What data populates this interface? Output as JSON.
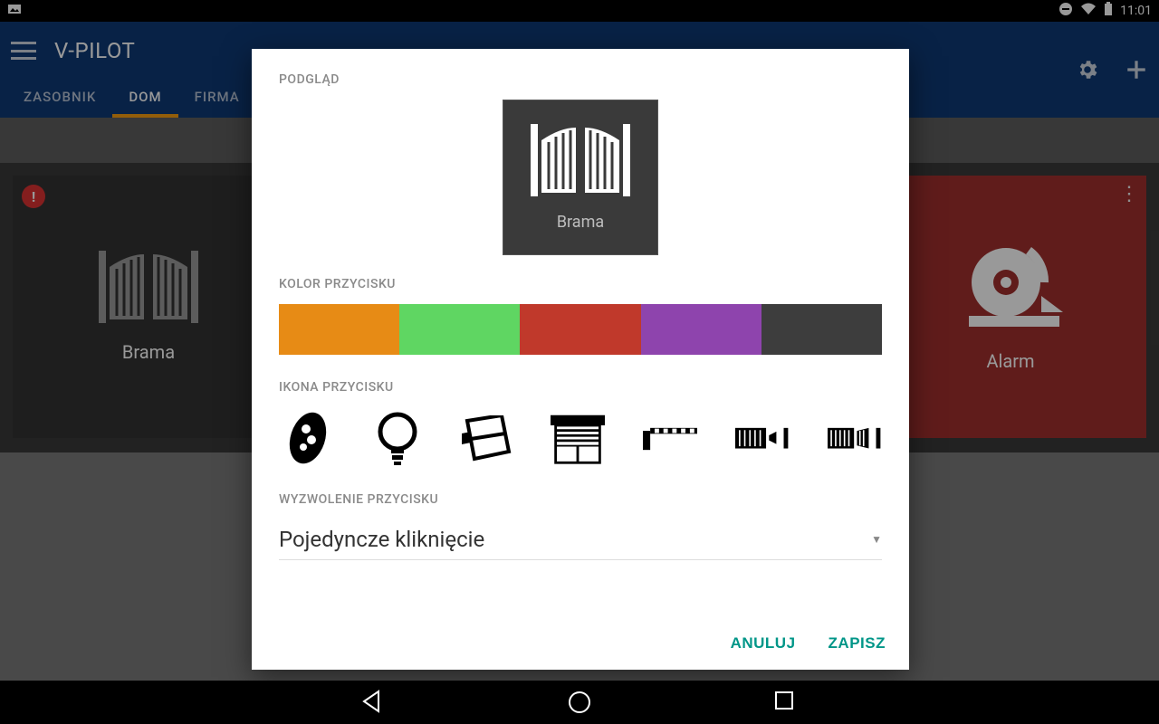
{
  "statusbar": {
    "time": "11:01"
  },
  "appbar": {
    "title": "V-PILOT",
    "tabs": [
      {
        "label": "ZASOBNIK",
        "active": false
      },
      {
        "label": "DOM",
        "active": true
      },
      {
        "label": "FIRMA",
        "active": false
      }
    ]
  },
  "tiles": {
    "left": {
      "label": "Brama"
    },
    "right": {
      "label": "Alarm"
    }
  },
  "dialog": {
    "sections": {
      "preview_label": "PODGLĄD",
      "preview_caption": "Brama",
      "color_label": "KOLOR PRZYCISKU",
      "icon_label": "IKONA PRZYCISKU",
      "trigger_label": "WYZWOLENIE PRZYCISKU",
      "trigger_value": "Pojedyncze kliknięcie"
    },
    "colors": [
      "#e78b15",
      "#5fd662",
      "#c0392b",
      "#8e44ad",
      "#3d3d3d"
    ],
    "icons": [
      "remote-icon",
      "bulb-icon",
      "window-icon",
      "shutter-icon",
      "barrier-icon",
      "gate-sliding-icon",
      "gate-swing-icon"
    ],
    "actions": {
      "cancel": "ANULUJ",
      "save": "ZAPISZ"
    }
  }
}
